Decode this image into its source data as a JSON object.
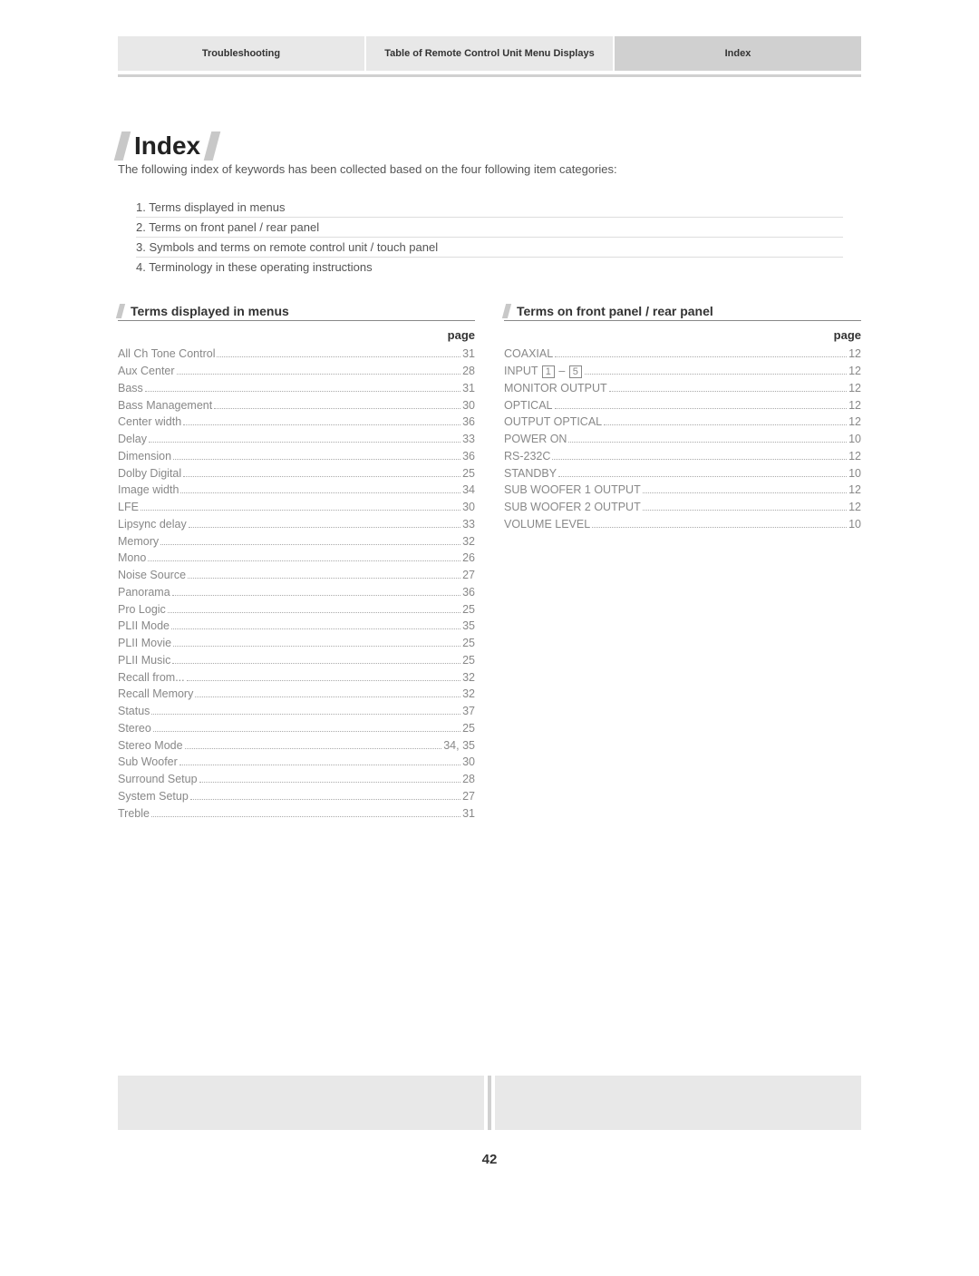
{
  "tabs": {
    "troubleshooting": "Troubleshooting",
    "table_menu": "Table of Remote Control Unit Menu Displays",
    "index": "Index"
  },
  "title": "Index",
  "intro": "The following index of keywords has been collected based on the four following item categories:",
  "categories": [
    "1. Terms displayed in menus",
    "2. Terms on front panel / rear panel",
    "3. Symbols and terms on remote control unit / touch panel",
    "4. Terminology in these operating instructions"
  ],
  "page_label": "page",
  "section_menus": "Terms displayed in menus",
  "section_panel": "Terms on front panel / rear panel",
  "menus_entries": [
    {
      "term": "All Ch Tone Control",
      "pg": "31"
    },
    {
      "term": "Aux Center",
      "pg": "28"
    },
    {
      "term": "Bass",
      "pg": "31"
    },
    {
      "term": "Bass Management",
      "pg": "30"
    },
    {
      "term": "Center width",
      "pg": "36"
    },
    {
      "term": "Delay",
      "pg": "33"
    },
    {
      "term": "Dimension",
      "pg": "36"
    },
    {
      "term": "Dolby Digital",
      "pg": "25"
    },
    {
      "term": "Image width",
      "pg": "34"
    },
    {
      "term": "LFE",
      "pg": "30"
    },
    {
      "term": "Lipsync delay",
      "pg": "33"
    },
    {
      "term": "Memory",
      "pg": "32"
    },
    {
      "term": "Mono",
      "pg": "26"
    },
    {
      "term": "Noise Source",
      "pg": "27"
    },
    {
      "term": "Panorama",
      "pg": "36"
    },
    {
      "term": "Pro Logic",
      "pg": "25"
    },
    {
      "term": "PLII Mode",
      "pg": "35"
    },
    {
      "term": "PLII Movie",
      "pg": "25"
    },
    {
      "term": "PLII Music",
      "pg": "25"
    },
    {
      "term": "Recall from...",
      "pg": "32"
    },
    {
      "term": "Recall Memory",
      "pg": "32"
    },
    {
      "term": "Status",
      "pg": "37"
    },
    {
      "term": "Stereo",
      "pg": "25"
    },
    {
      "term": "Stereo Mode",
      "pg": "34, 35"
    },
    {
      "term": "Sub Woofer",
      "pg": "30"
    },
    {
      "term": "Surround Setup",
      "pg": "28"
    },
    {
      "term": "System Setup",
      "pg": "27"
    },
    {
      "term": "Treble",
      "pg": "31"
    }
  ],
  "panel_entries": [
    {
      "term": "COAXIAL",
      "pg": "12"
    },
    {
      "term": "INPUT",
      "boxnums": [
        "1",
        "5"
      ],
      "dash": "–",
      "pg": "12"
    },
    {
      "term": "MONITOR OUTPUT",
      "pg": "12"
    },
    {
      "term": "OPTICAL",
      "pg": "12"
    },
    {
      "term": "OUTPUT OPTICAL",
      "pg": "12"
    },
    {
      "term": "POWER ON",
      "pg": "10"
    },
    {
      "term": "RS-232C",
      "pg": "12"
    },
    {
      "term": "STANDBY",
      "pg": "10"
    },
    {
      "term": "SUB WOOFER 1 OUTPUT",
      "pg": "12"
    },
    {
      "term": "SUB WOOFER 2 OUTPUT",
      "pg": "12"
    },
    {
      "term": "VOLUME LEVEL",
      "pg": "10"
    }
  ],
  "page_number": "42"
}
